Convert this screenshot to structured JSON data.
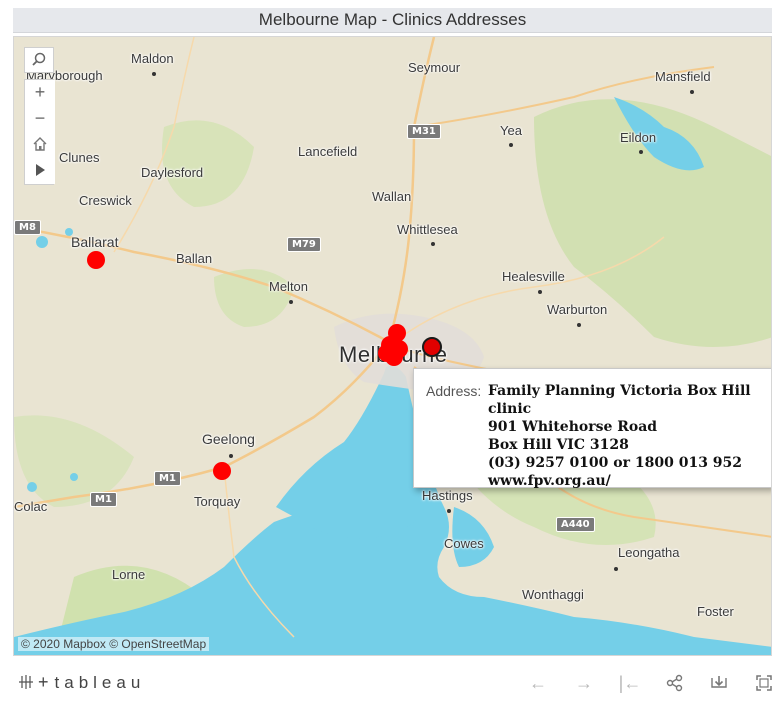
{
  "title": "Melbourne Map - Clinics Addresses",
  "colors": {
    "water": "#74cfe8",
    "land": "#e9e4d2",
    "park": "#c5dca0",
    "clinic": "#ff0000"
  },
  "map_tools": {
    "search_icon": "search-icon",
    "zoom_in": "+",
    "zoom_out": "−",
    "home_icon": "home-icon",
    "pan_icon": "play-arrow-icon"
  },
  "places": {
    "maldon": "Maldon",
    "maryborough": "Maryborough",
    "seymour": "Seymour",
    "mansfield": "Mansfield",
    "yea": "Yea",
    "eildon": "Eildon",
    "clunes": "Clunes",
    "daylesford": "Daylesford",
    "lancefield": "Lancefield",
    "creswick": "Creswick",
    "wallan": "Wallan",
    "whittlesea": "Whittlesea",
    "ballarat": "Ballarat",
    "ballan": "Ballan",
    "healesville": "Healesville",
    "melton": "Melton",
    "warburton": "Warburton",
    "melbourne": "Melbourne",
    "geelong": "Geelong",
    "torquay": "Torquay",
    "colac": "Colac",
    "hastings": "Hastings",
    "cowes": "Cowes",
    "leongatha": "Leongatha",
    "lorne": "Lorne",
    "wonthaggi": "Wonthaggi",
    "foster": "Foster"
  },
  "roads": {
    "m31": "M31",
    "m79": "M79",
    "m8": "M8",
    "m1a": "M1",
    "m1b": "M1",
    "a440": "A440"
  },
  "tooltip": {
    "label": "Address:",
    "lines": [
      "Family Planning Victoria Box Hill clinic",
      "901 Whitehorse Road",
      "Box Hill VIC 3128",
      "(03) 9257 0100 or 1800 013 952",
      "www.fpv.org.au/"
    ]
  },
  "attribution": "© 2020 Mapbox © OpenStreetMap",
  "footer": {
    "brand": "tableau",
    "brand_icon": "tableau-logo-icon",
    "undo": "←",
    "redo": "→",
    "revert": "|←",
    "share_icon": "share-icon",
    "download_icon": "download-icon",
    "fullscreen_icon": "fullscreen-icon"
  }
}
